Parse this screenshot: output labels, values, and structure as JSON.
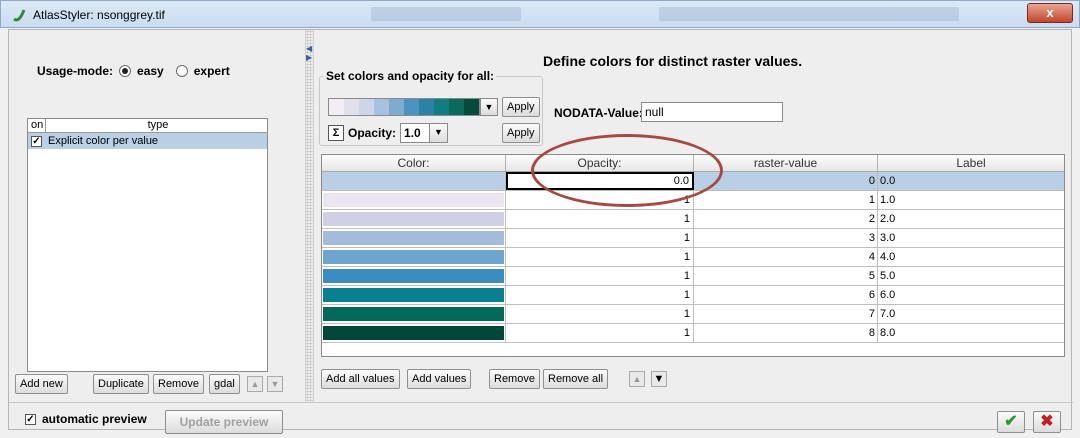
{
  "window": {
    "title": "AtlasStyler: nsonggrey.tif",
    "close_label": "x"
  },
  "usage": {
    "label": "Usage-mode:",
    "options": [
      "easy",
      "expert"
    ],
    "selected": "easy"
  },
  "type_table": {
    "headers": [
      "on",
      "type"
    ],
    "rows": [
      {
        "checked": true,
        "type": "Explicit color per value"
      }
    ]
  },
  "left_buttons": {
    "add_new": "Add new",
    "duplicate": "Duplicate",
    "remove": "Remove",
    "gdal": "gdal"
  },
  "heading": "Define colors for distinct raster values.",
  "set_all": {
    "title": "Set colors and opacity for all:",
    "apply_label": "Apply",
    "opacity_label": "Opacity:",
    "opacity_value": "1.0",
    "palette": [
      "#f3eef6",
      "#e3e0ee",
      "#cdd5e8",
      "#a8c1de",
      "#7eacd0",
      "#4d93c2",
      "#2b82a6",
      "#107e7e",
      "#0a6b5c",
      "#044a3d"
    ]
  },
  "nodata": {
    "label": "NODATA-Value:",
    "value": "null"
  },
  "grid": {
    "headers": [
      "Color:",
      "Opacity:",
      "raster-value",
      "Label"
    ],
    "rows": [
      {
        "color": "",
        "opacity": "0.0",
        "raster_value": "0",
        "label": "0.0"
      },
      {
        "color": "#ece4f0",
        "opacity": "1",
        "raster_value": "1",
        "label": "1.0"
      },
      {
        "color": "#cfcfe6",
        "opacity": "1",
        "raster_value": "2",
        "label": "2.0"
      },
      {
        "color": "#a4bcd9",
        "opacity": "1",
        "raster_value": "3",
        "label": "3.0"
      },
      {
        "color": "#6fa4cf",
        "opacity": "1",
        "raster_value": "4",
        "label": "4.0"
      },
      {
        "color": "#3a8dc1",
        "opacity": "1",
        "raster_value": "5",
        "label": "5.0"
      },
      {
        "color": "#0a7f8f",
        "opacity": "1",
        "raster_value": "6",
        "label": "6.0"
      },
      {
        "color": "#036a59",
        "opacity": "1",
        "raster_value": "7",
        "label": "7.0"
      },
      {
        "color": "#024739",
        "opacity": "1",
        "raster_value": "8",
        "label": "8.0"
      }
    ]
  },
  "grid_buttons": {
    "add_all_values": "Add all values",
    "add_values": "Add values",
    "remove": "Remove",
    "remove_all": "Remove all"
  },
  "bottom": {
    "auto_preview_label": "automatic preview",
    "auto_preview_checked": true,
    "update_preview": "Update preview"
  }
}
